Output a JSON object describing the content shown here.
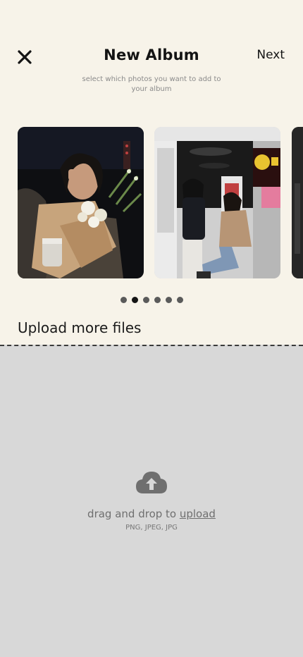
{
  "header": {
    "title": "New Album",
    "subtitle_line1": "select which photos you want to add to",
    "subtitle_line2": "your album",
    "next_label": "Next",
    "close_icon": "close-icon"
  },
  "carousel": {
    "photos": [
      {
        "name": "photo-woman-flowers"
      },
      {
        "name": "photo-two-women-storefront"
      },
      {
        "name": "photo-partial"
      }
    ],
    "dots_count": 6,
    "active_dot": 2
  },
  "upload": {
    "section_title": "Upload more files",
    "drop_prefix": "drag and drop to ",
    "drop_link": "upload",
    "formats": "PNG, JPEG, JPG",
    "icon": "cloud-upload-icon"
  },
  "colors": {
    "background": "#f7f3e9",
    "dropzone": "#d8d8d8",
    "text": "#141414"
  }
}
